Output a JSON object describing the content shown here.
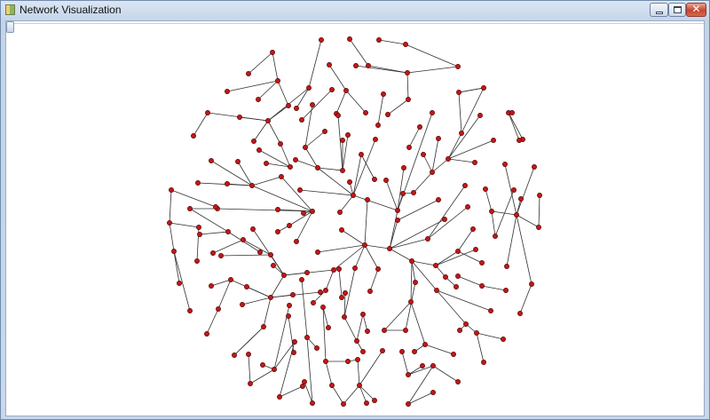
{
  "window": {
    "title": "Network Visualization",
    "close_symbol": "✕"
  },
  "icons": {
    "app": "app-icon",
    "minimize": "minimize-icon",
    "maximize": "maximize-icon",
    "close": "close-icon"
  },
  "colors": {
    "node": "#c01818",
    "edge": "#303030"
  }
}
